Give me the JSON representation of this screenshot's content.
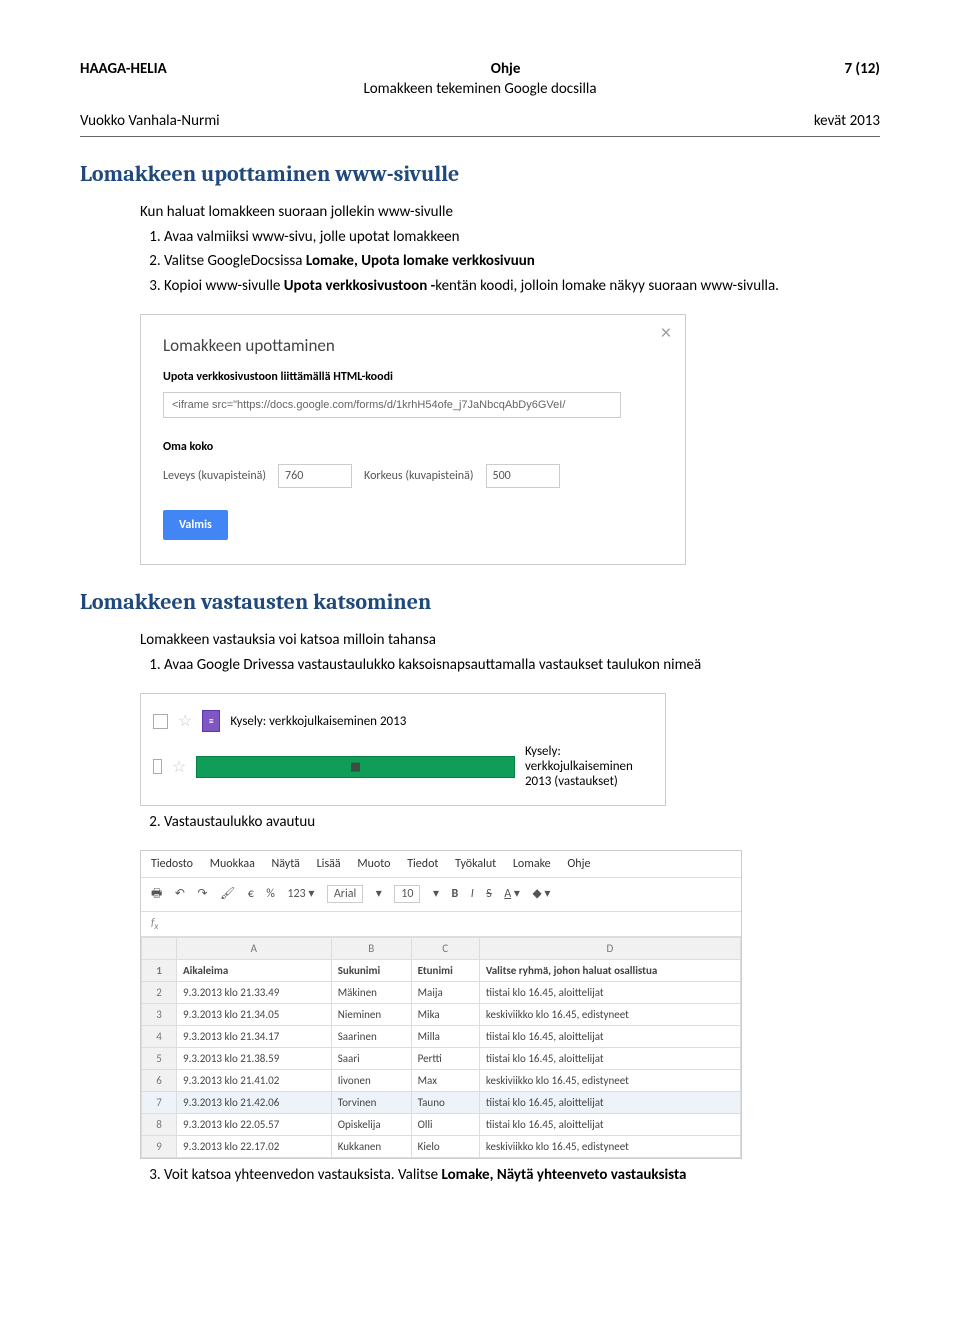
{
  "header": {
    "left": "HAAGA-HELIA",
    "center1": "Ohje",
    "right": "7 (12)",
    "center2": "Lomakkeen tekeminen Google docsilla",
    "author": "Vuokko Vanhala-Nurmi",
    "term": "kevät 2013"
  },
  "s1": {
    "title": "Lomakkeen upottaminen www-sivulle",
    "intro": "Kun haluat lomakkeen suoraan jollekin www-sivulle",
    "li1": "Avaa valmiiksi  www-sivu, jolle upotat lomakkeen",
    "li2a": "Valitse GoogleDocsissa  ",
    "li2b": "Lomake, Upota lomake verkkosivuun",
    "li3a": "Kopioi www-sivulle ",
    "li3b": "Upota verkkosivustoon -",
    "li3c": "kentän koodi, jolloin lomake näkyy suoraan www-sivulla."
  },
  "dlg": {
    "title": "Lomakkeen upottaminen",
    "sub": "Upota verkkosivustoon liittämällä HTML-koodi",
    "code": "<iframe src=\"https://docs.google.com/forms/d/1krhH54ofe_j7JaNbcqAbDy6GVeI/",
    "own": "Oma koko",
    "wlabel": "Leveys (kuvapisteinä)",
    "wval": "760",
    "hlabel": "Korkeus (kuvapisteinä)",
    "hval": "500",
    "done": "Valmis"
  },
  "s2": {
    "title": "Lomakkeen vastausten katsominen",
    "intro": "Lomakkeen vastauksia voi katsoa milloin tahansa",
    "li1": "Avaa Google Drivessa vastaustaulukko kaksoisnapsauttamalla vastaukset taulukon nimeä",
    "li2": "Vastaustaulukko avautuu",
    "li3a": "Voit katsoa yhteenvedon vastauksista.  Valitse ",
    "li3b": "Lomake, Näytä yhteenveto vastauksista"
  },
  "drive": {
    "r1": "Kysely: verkkojulkaiseminen 2013",
    "r2": "Kysely: verkkojulkaiseminen 2013 (vastaukset)"
  },
  "menu": {
    "m0": "Tiedosto",
    "m1": "Muokkaa",
    "m2": "Näytä",
    "m3": "Lisää",
    "m4": "Muoto",
    "m5": "Tiedot",
    "m6": "Työkalut",
    "m7": "Lomake",
    "m8": "Ohje"
  },
  "tb": {
    "font": "Arial",
    "size": "10"
  },
  "cols": {
    "A": "A",
    "B": "B",
    "C": "C",
    "D": "D"
  },
  "hdr": {
    "A": "Aikaleima",
    "B": "Sukunimi",
    "C": "Etunimi",
    "D": "Valitse ryhmä, johon haluat osallistua"
  },
  "rows": [
    {
      "n": "2",
      "A": "9.3.2013 klo 21.33.49",
      "B": "Mäkinen",
      "C": "Maija",
      "D": "tiistai klo 16.45, aloittelijat"
    },
    {
      "n": "3",
      "A": "9.3.2013 klo 21.34.05",
      "B": "Nieminen",
      "C": "Mika",
      "D": "keskiviikko klo 16.45, edistyneet"
    },
    {
      "n": "4",
      "A": "9.3.2013 klo 21.34.17",
      "B": "Saarinen",
      "C": "Milla",
      "D": "tiistai klo 16.45, aloittelijat"
    },
    {
      "n": "5",
      "A": "9.3.2013 klo 21.38.59",
      "B": "Saari",
      "C": "Pertti",
      "D": "tiistai klo 16.45, aloittelijat"
    },
    {
      "n": "6",
      "A": "9.3.2013 klo 21.41.02",
      "B": "Iivonen",
      "C": "Max",
      "D": "keskiviikko klo 16.45, edistyneet"
    },
    {
      "n": "7",
      "A": "9.3.2013 klo 21.42.06",
      "B": "Torvinen",
      "C": "Tauno",
      "D": "tiistai klo 16.45, aloittelijat"
    },
    {
      "n": "8",
      "A": "9.3.2013 klo 22.05.57",
      "B": "Opiskelija",
      "C": "Olli",
      "D": "tiistai klo 16.45, aloittelijat"
    },
    {
      "n": "9",
      "A": "9.3.2013 klo 22.17.02",
      "B": "Kukkanen",
      "C": "Kielo",
      "D": "keskiviikko klo 16.45, edistyneet"
    }
  ]
}
